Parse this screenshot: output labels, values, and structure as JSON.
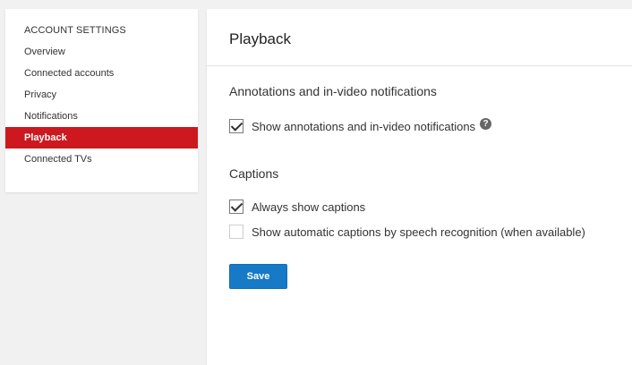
{
  "sidebar": {
    "heading": "ACCOUNT SETTINGS",
    "items": [
      {
        "label": "Overview"
      },
      {
        "label": "Connected accounts"
      },
      {
        "label": "Privacy"
      },
      {
        "label": "Notifications"
      },
      {
        "label": "Playback",
        "active": true
      },
      {
        "label": "Connected TVs"
      }
    ]
  },
  "main": {
    "title": "Playback",
    "annotations": {
      "title": "Annotations and in-video notifications",
      "show_annotations": {
        "label": "Show annotations and in-video notifications",
        "checked": true,
        "help_glyph": "?"
      }
    },
    "captions": {
      "title": "Captions",
      "always_show": {
        "label": "Always show captions",
        "checked": true
      },
      "automatic": {
        "label": "Show automatic captions by speech recognition (when available)",
        "checked": false
      }
    },
    "save_label": "Save"
  },
  "colors": {
    "active_item": "#cc181e",
    "primary_button": "#167ac6",
    "background": "#f1f1f1"
  },
  "icons": {
    "help": "help-icon",
    "checkbox": "checkmark-icon"
  }
}
